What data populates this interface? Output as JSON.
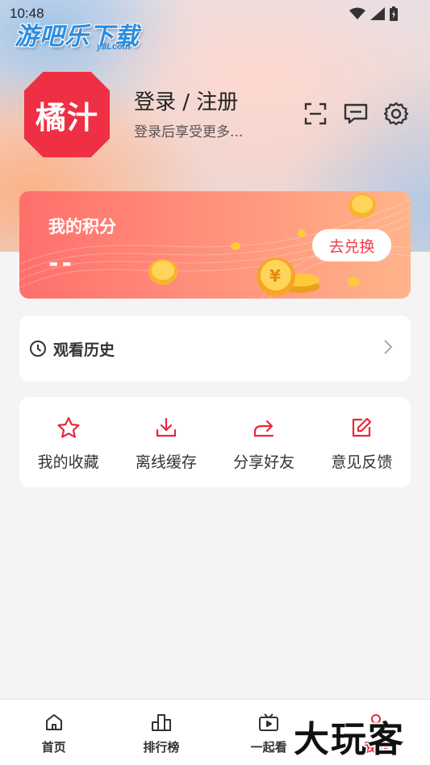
{
  "status_bar": {
    "time": "10:48"
  },
  "watermarks": {
    "top": "游吧乐下载",
    "top_sub": "y8Lcom",
    "bottom": "大玩客"
  },
  "profile": {
    "avatar_text": "橘汁",
    "login_title": "登录 / 注册",
    "login_subtitle": "登录后享受更多...",
    "icons": [
      "scan-icon",
      "message-icon",
      "settings-icon"
    ]
  },
  "points": {
    "title": "我的积分",
    "value": "--",
    "exchange_label": "去兑换"
  },
  "history": {
    "label": "观看历史"
  },
  "actions": [
    {
      "label": "我的收藏",
      "icon": "star-icon"
    },
    {
      "label": "离线缓存",
      "icon": "download-icon"
    },
    {
      "label": "分享好友",
      "icon": "share-icon"
    },
    {
      "label": "意见反馈",
      "icon": "edit-icon"
    }
  ],
  "tabs": [
    {
      "label": "首页",
      "icon": "home-icon",
      "active": false
    },
    {
      "label": "排行榜",
      "icon": "chart-icon",
      "active": false
    },
    {
      "label": "一起看",
      "icon": "tv-icon",
      "active": false
    },
    {
      "label": "我的",
      "icon": "profile-icon",
      "active": true
    }
  ],
  "colors": {
    "accent": "#e8283a",
    "avatar_bg": "#ef2f43",
    "card_start": "#ff6f6b",
    "card_end": "#ffb48a"
  }
}
